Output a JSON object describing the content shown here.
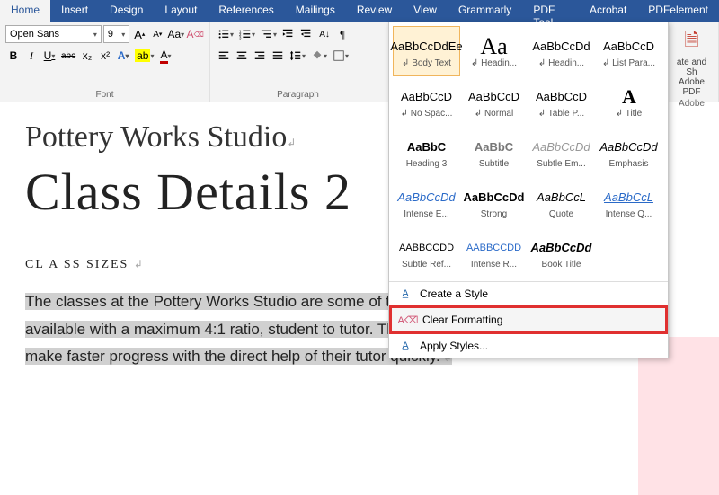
{
  "tabs": [
    "Home",
    "Insert",
    "Design",
    "Layout",
    "References",
    "Mailings",
    "Review",
    "View",
    "Grammarly",
    "PDF Tool Set",
    "Acrobat",
    "PDFelement"
  ],
  "activeTab": 0,
  "font": {
    "name": "Open Sans",
    "size": "9",
    "grow": "A",
    "shrink": "A",
    "case": "Aa",
    "clear": "A",
    "bold": "B",
    "italic": "I",
    "underline": "U",
    "strike": "abc",
    "sub": "x₂",
    "sup": "x²",
    "effects": "A",
    "highlight": "ab",
    "color": "A",
    "group_label": "Font"
  },
  "para": {
    "group_label": "Paragraph"
  },
  "adobe": {
    "btn": "ate and Sh",
    "line2": "Adobe PDF",
    "group_label": "Adobe"
  },
  "styles": {
    "items": [
      {
        "prev": "AaBbCcDdEe",
        "label": "↲ Body Text",
        "cls": ""
      },
      {
        "prev": "Aa",
        "label": "↲ Headin...",
        "cls": "big serif"
      },
      {
        "prev": "AaBbCcDd",
        "label": "↲ Headin...",
        "cls": ""
      },
      {
        "prev": "AaBbCcD",
        "label": "↲ List Para...",
        "cls": ""
      },
      {
        "prev": "AaBbCcD",
        "label": "↲ No Spac...",
        "cls": ""
      },
      {
        "prev": "AaBbCcD",
        "label": "↲ Normal",
        "cls": ""
      },
      {
        "prev": "AaBbCcD",
        "label": "↲ Table P...",
        "cls": ""
      },
      {
        "prev": "A",
        "label": "↲ Title",
        "cls": "titleprev"
      },
      {
        "prev": "AaBbC",
        "label": "Heading 3",
        "cls": "bold"
      },
      {
        "prev": "AaBbC",
        "label": "Subtitle",
        "cls": "boldgray"
      },
      {
        "prev": "AaBbCcDd",
        "label": "Subtle Em...",
        "cls": "italicgray"
      },
      {
        "prev": "AaBbCcDd",
        "label": "Emphasis",
        "cls": "italic"
      },
      {
        "prev": "AaBbCcDd",
        "label": "Intense E...",
        "cls": "italicblue"
      },
      {
        "prev": "AaBbCcDd",
        "label": "Strong",
        "cls": "bold"
      },
      {
        "prev": "AaBbCcL",
        "label": "Quote",
        "cls": "italic"
      },
      {
        "prev": "AaBbCcL",
        "label": "Intense Q...",
        "cls": "italicblueU"
      },
      {
        "prev": "AABBCCDD",
        "label": "Subtle Ref...",
        "cls": "smallcaps"
      },
      {
        "prev": "AABBCCDD",
        "label": "Intense R...",
        "cls": "smallcapsblue"
      },
      {
        "prev": "AaBbCcDd",
        "label": "Book Title",
        "cls": "bolditalic"
      }
    ],
    "menu": {
      "create": "Create a Style",
      "clear": "Clear Formatting",
      "apply": "Apply Styles..."
    }
  },
  "doc": {
    "h1": "Pottery Works Studio",
    "title2": "Class Details 2",
    "sizes": "CL A SS SIZES",
    "para": "The classes at the Pottery Works Studio are some of the smallest wheel- throwing classes available with a maximum 4:1 ratio, student to tutor. The reason for this is so that students can make faster progress with the direct help of their tutor quickly."
  }
}
